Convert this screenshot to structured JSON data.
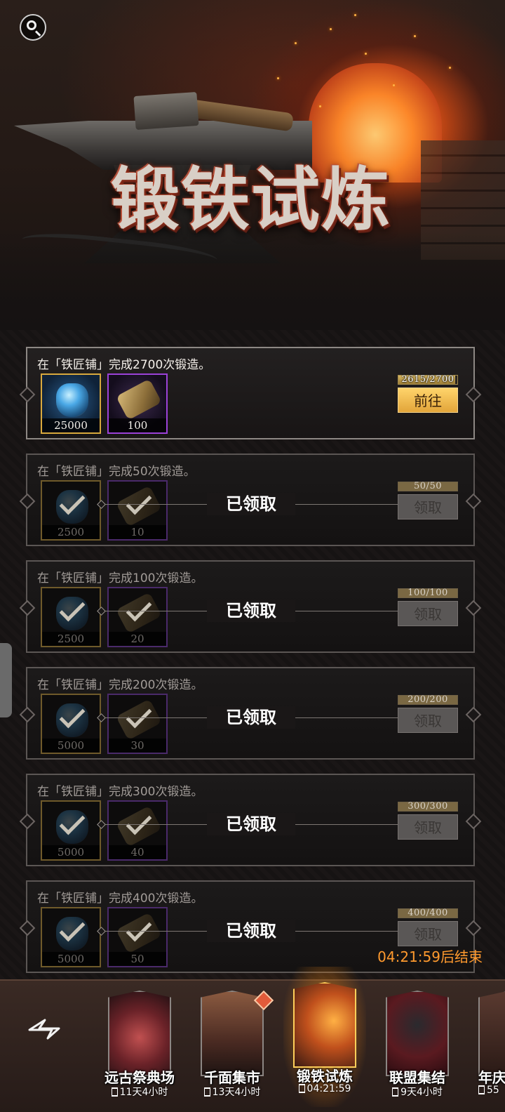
{
  "banner": {
    "title": "锻铁试炼"
  },
  "tasks": [
    {
      "title": "在「铁匠铺」完成2700次锻造。",
      "rewards": [
        {
          "qty": "25000"
        },
        {
          "qty": "100"
        }
      ],
      "progress_text": "2615/2700",
      "progress_fraction": 0.969,
      "button": "前往",
      "claimed": false
    },
    {
      "title": "在「铁匠铺」完成50次锻造。",
      "rewards": [
        {
          "qty": "2500"
        },
        {
          "qty": "10"
        }
      ],
      "progress_text": "50/50",
      "progress_fraction": 1.0,
      "button": "领取",
      "claimed": true,
      "claimed_label": "已领取"
    },
    {
      "title": "在「铁匠铺」完成100次锻造。",
      "rewards": [
        {
          "qty": "2500"
        },
        {
          "qty": "20"
        }
      ],
      "progress_text": "100/100",
      "progress_fraction": 1.0,
      "button": "领取",
      "claimed": true,
      "claimed_label": "已领取"
    },
    {
      "title": "在「铁匠铺」完成200次锻造。",
      "rewards": [
        {
          "qty": "5000"
        },
        {
          "qty": "30"
        }
      ],
      "progress_text": "200/200",
      "progress_fraction": 1.0,
      "button": "领取",
      "claimed": true,
      "claimed_label": "已领取"
    },
    {
      "title": "在「铁匠铺」完成300次锻造。",
      "rewards": [
        {
          "qty": "5000"
        },
        {
          "qty": "40"
        }
      ],
      "progress_text": "300/300",
      "progress_fraction": 1.0,
      "button": "领取",
      "claimed": true,
      "claimed_label": "已领取"
    },
    {
      "title": "在「铁匠铺」完成400次锻造。",
      "rewards": [
        {
          "qty": "5000"
        },
        {
          "qty": "50"
        }
      ],
      "progress_text": "400/400",
      "progress_fraction": 1.0,
      "button": "领取",
      "claimed": true,
      "claimed_label": "已领取"
    }
  ],
  "countdown": "04:21:59后结束",
  "events": [
    {
      "name": "远古祭典场",
      "timer": "11天4小时",
      "art_color": "#7a2a2a",
      "selected": false
    },
    {
      "name": "千面集市",
      "timer": "13天4小时",
      "art_color": "#6a3226",
      "selected": false,
      "badge": true
    },
    {
      "name": "锻铁试炼",
      "timer": "04:21:59",
      "art_color": "#8a4020",
      "selected": true
    },
    {
      "name": "联盟集结",
      "timer": "9天4小时",
      "art_color": "#5a1a1e",
      "selected": false
    },
    {
      "name": "年庆",
      "timer": "55",
      "art_color": "#4a2a22",
      "selected": false
    }
  ],
  "icons": {
    "search": "search-icon",
    "reward_1": "essence-gem-icon",
    "reward_2": "scroll-icon",
    "claimed_check": "checkmark-icon",
    "event_timer": "hourglass-icon",
    "nav_logo": "logo-icon"
  },
  "colors": {
    "accent_gold": "#e2a53a",
    "countdown_orange": "#ff9a2e",
    "selected_glow": "#ffb02c"
  }
}
